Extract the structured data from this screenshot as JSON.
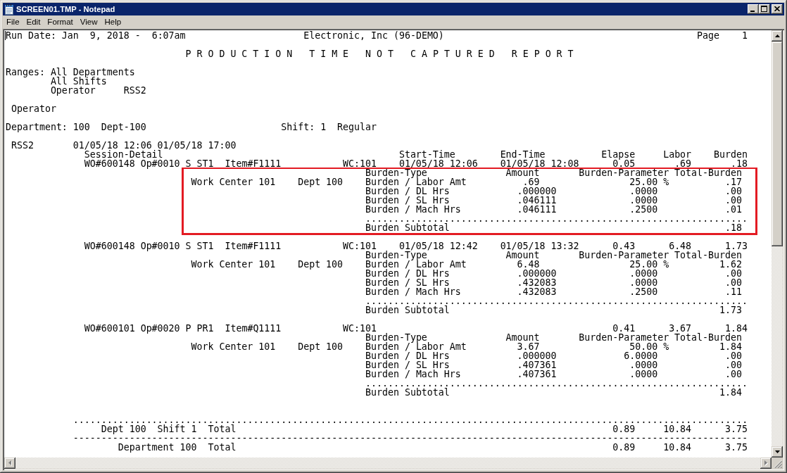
{
  "window": {
    "title": "SCREEN01.TMP - Notepad"
  },
  "menu": [
    "File",
    "Edit",
    "Format",
    "View",
    "Help"
  ],
  "report": {
    "header": {
      "run_date": "Run Date: Jan  9, 2018 -  6:07am",
      "company": "Electronic, Inc (96-DEMO)",
      "page_label": "Page",
      "page_number": "1"
    },
    "title": "P R O D U C T I O N   T I M E   N O T   C A P T U R E D   R E P O R T",
    "ranges": {
      "label": "Ranges:",
      "items": [
        {
          "name": "All Departments"
        },
        {
          "name": "All Shifts"
        },
        {
          "name": "Operator",
          "value": "RSS2"
        }
      ]
    },
    "group_heading": "Operator",
    "department": {
      "name": "Department: 100  Dept-100",
      "shift": "Shift: 1  Regular"
    },
    "operator": {
      "code": "RSS2",
      "session": "01/05/18 12:06 01/05/18 17:00",
      "detail_label": "Session-Detail",
      "columns": [
        "Start-Time",
        "End-Time",
        "Elapse",
        "Labor",
        "Burden"
      ]
    },
    "operations": [
      {
        "title": "WO#600148 Op#0010 S ST1  Item#F1111",
        "work_center_code": "WC:101",
        "start": "01/05/18 12:06",
        "end": "01/05/18 12:08",
        "elapse": "0.05",
        "labor": ".69",
        "burden": ".18",
        "highlighted": true,
        "burden_columns": [
          "Burden-Type",
          "Amount",
          "Burden-Parameter",
          "Total-Burden"
        ],
        "work_center": "Work Center 101",
        "dept": "Dept 100",
        "burdens": [
          {
            "kind": "labor",
            "type": "Burden / Labor Amt",
            "amount": ".69",
            "parameter": "25.00 %",
            "total": ".17"
          },
          {
            "kind": "hours",
            "type": "Burden / DL Hrs",
            "amount": ".000000",
            "parameter": ".0000",
            "total": ".00"
          },
          {
            "kind": "hours",
            "type": "Burden / SL Hrs",
            "amount": ".046111",
            "parameter": ".0000",
            "total": ".00"
          },
          {
            "kind": "hours",
            "type": "Burden / Mach Hrs",
            "amount": ".046111",
            "parameter": ".2500",
            "total": ".01"
          }
        ],
        "rule": "....................................................................",
        "subtotal_label": "Burden Subtotal",
        "subtotal": ".18"
      },
      {
        "title": "WO#600148 Op#0010 S ST1  Item#F1111",
        "work_center_code": "WC:101",
        "start": "01/05/18 12:42",
        "end": "01/05/18 13:32",
        "elapse": "0.43",
        "labor": "6.48",
        "burden": "1.73",
        "highlighted": false,
        "burden_columns": [
          "Burden-Type",
          "Amount",
          "Burden-Parameter",
          "Total-Burden"
        ],
        "work_center": "Work Center 101",
        "dept": "Dept 100",
        "burdens": [
          {
            "kind": "labor",
            "type": "Burden / Labor Amt",
            "amount": "6.48",
            "parameter": "25.00 %",
            "total": "1.62"
          },
          {
            "kind": "hours",
            "type": "Burden / DL Hrs",
            "amount": ".000000",
            "parameter": ".0000",
            "total": ".00"
          },
          {
            "kind": "hours",
            "type": "Burden / SL Hrs",
            "amount": ".432083",
            "parameter": ".0000",
            "total": ".00"
          },
          {
            "kind": "hours",
            "type": "Burden / Mach Hrs",
            "amount": ".432083",
            "parameter": ".2500",
            "total": ".11"
          }
        ],
        "rule": "....................................................................",
        "subtotal_label": "Burden Subtotal",
        "subtotal": "1.73"
      },
      {
        "title": "WO#600101 Op#0020 P PR1  Item#Q1111",
        "work_center_code": "WC:101",
        "elapse": "0.41",
        "labor": "3.67",
        "burden": "1.84",
        "highlighted": false,
        "burden_columns": [
          "Burden-Type",
          "Amount",
          "Burden-Parameter",
          "Total-Burden"
        ],
        "work_center": "Work Center 101",
        "dept": "Dept 100",
        "burdens": [
          {
            "kind": "labor",
            "type": "Burden / Labor Amt",
            "amount": "3.67",
            "parameter": "50.00 %",
            "total": "1.84"
          },
          {
            "kind": "hours",
            "type": "Burden / DL Hrs",
            "amount": ".000000",
            "parameter": "6.0000",
            "total": ".00"
          },
          {
            "kind": "hours",
            "type": "Burden / SL Hrs",
            "amount": ".407361",
            "parameter": ".0000",
            "total": ".00"
          },
          {
            "kind": "hours",
            "type": "Burden / Mach Hrs",
            "amount": ".407361",
            "parameter": ".0000",
            "total": ".00"
          }
        ],
        "rule": "....................................................................",
        "subtotal_label": "Burden Subtotal",
        "subtotal": "1.84"
      }
    ],
    "totals": [
      {
        "kind": "shift",
        "rule": "........................................................................................................................",
        "label": "Dept 100  Shift 1  Total",
        "elapse": "0.89",
        "labor": "10.84",
        "burden": "3.75"
      },
      {
        "kind": "department",
        "rule": "------------------------------------------------------------------------------------------------------------------------",
        "label": "Department 100  Total",
        "elapse": "0.89",
        "labor": "10.84",
        "burden": "3.75"
      }
    ]
  }
}
